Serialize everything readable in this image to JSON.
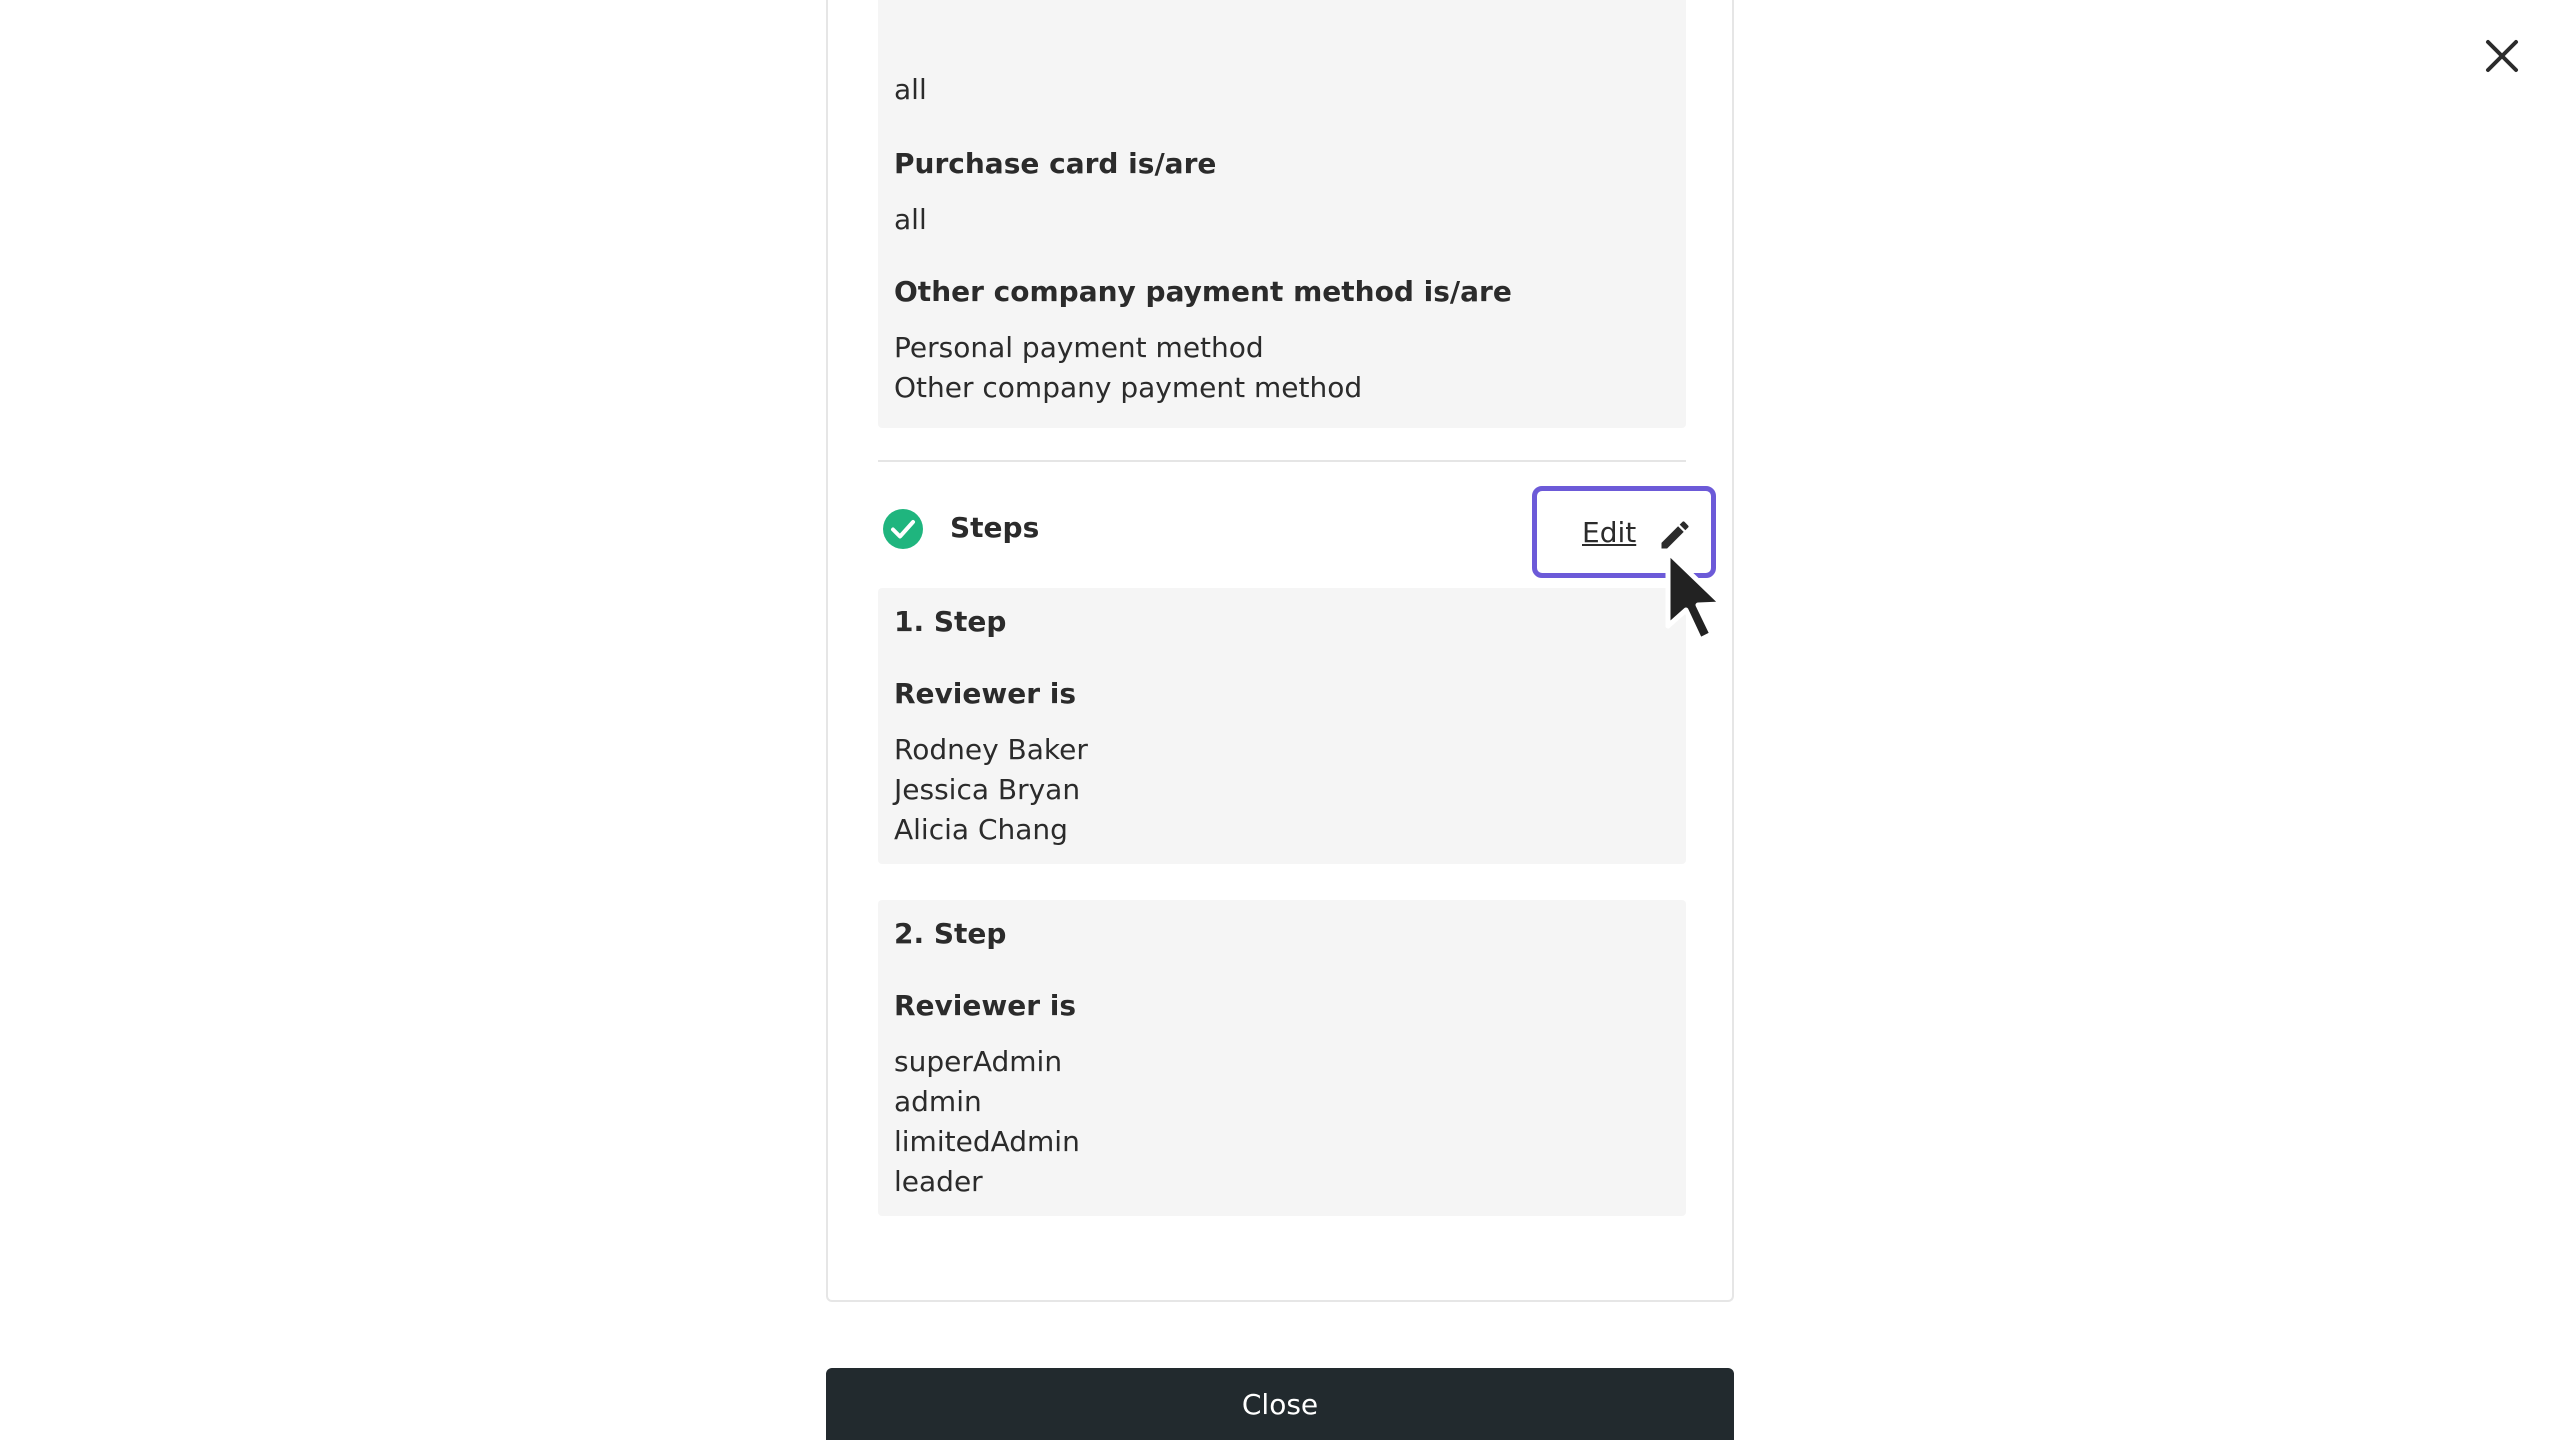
{
  "dialog": {
    "close_icon": "close-icon"
  },
  "conditions": {
    "partial_value": "all",
    "purchase_card": {
      "label": "Purchase card is/are",
      "value": "all"
    },
    "other_payment": {
      "label": "Other company payment method is/are",
      "values": [
        "Personal payment method",
        "Other company payment method"
      ]
    }
  },
  "steps": {
    "title": "Steps",
    "status_icon": "check-circle-icon",
    "status_color": "#1fb57e",
    "edit_label": "Edit",
    "edit_icon": "pencil-icon",
    "items": [
      {
        "title": "1. Step",
        "reviewer_label": "Reviewer is",
        "reviewers": [
          "Rodney Baker",
          "Jessica Bryan",
          "Alicia Chang"
        ]
      },
      {
        "title": "2. Step",
        "reviewer_label": "Reviewer is",
        "reviewers": [
          "superAdmin",
          "admin",
          "limitedAdmin",
          "leader"
        ]
      }
    ]
  },
  "footer": {
    "close_label": "Close"
  },
  "colors": {
    "focus_ring": "#6c5ad8",
    "close_button_bg": "#222a2e",
    "box_bg": "#f5f5f5"
  }
}
